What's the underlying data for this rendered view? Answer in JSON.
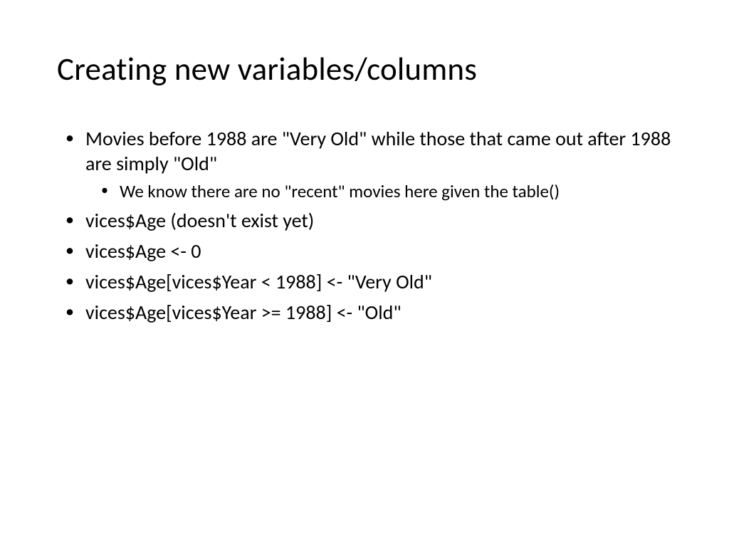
{
  "title": "Creating new variables/columns",
  "bullets": {
    "b1": "Movies before 1988 are \"Very Old\" while those that came out after 1988 are simply \"Old\"",
    "b1_sub1": "We know there are no \"recent\" movies here given the table()",
    "b2": "vices$Age (doesn't exist yet)",
    "b3": "vices$Age <- 0",
    "b4": "vices$Age[vices$Year < 1988] <- \"Very Old\"",
    "b5": "vices$Age[vices$Year >= 1988] <- \"Old\""
  }
}
